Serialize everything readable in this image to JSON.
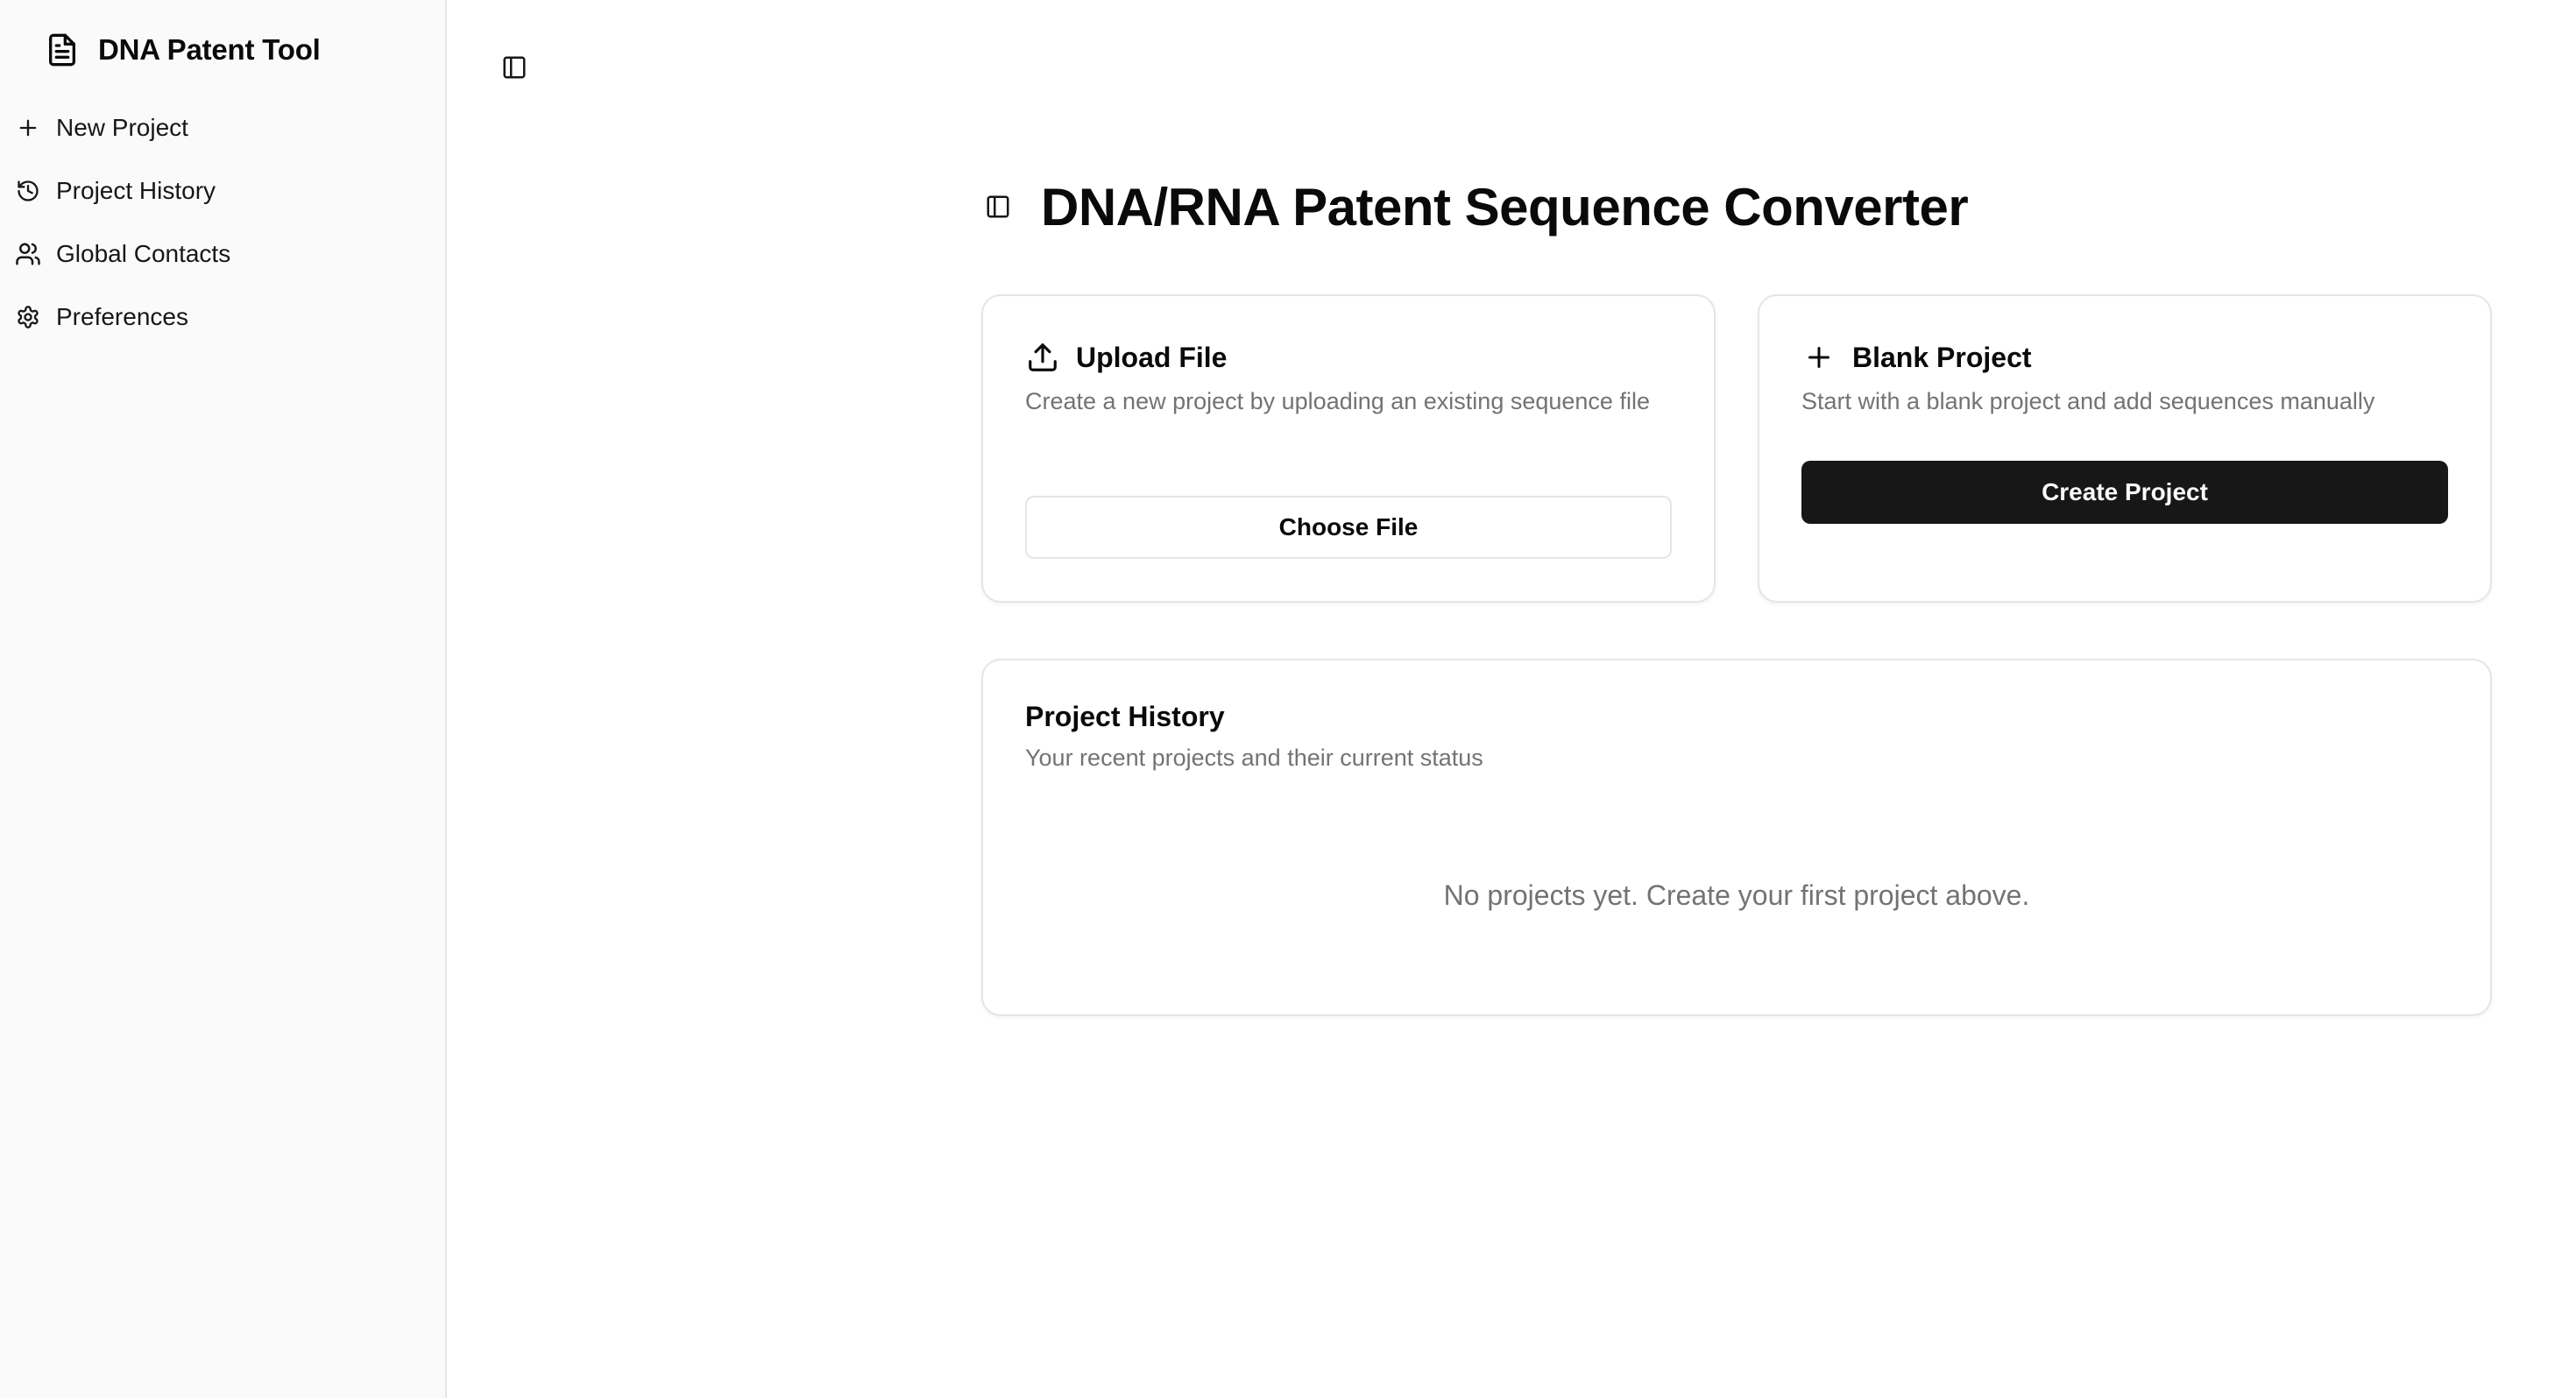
{
  "sidebar": {
    "brand": {
      "title": "DNA Patent Tool",
      "icon": "file-text-icon"
    },
    "items": [
      {
        "label": "New Project",
        "icon": "plus-icon"
      },
      {
        "label": "Project History",
        "icon": "history-icon"
      },
      {
        "label": "Global Contacts",
        "icon": "users-icon"
      },
      {
        "label": "Preferences",
        "icon": "gear-icon"
      }
    ]
  },
  "main": {
    "title": "DNA/RNA Patent Sequence Converter",
    "upload_card": {
      "title": "Upload File",
      "icon": "upload-icon",
      "description": "Create a new project by uploading an existing sequence file",
      "button_label": "Choose File"
    },
    "blank_card": {
      "title": "Blank Project",
      "icon": "plus-icon",
      "description": "Start with a blank project and add sequences manually",
      "button_label": "Create Project"
    },
    "history_card": {
      "title": "Project History",
      "description": "Your recent projects and their current status",
      "empty_message": "No projects yet. Create your first project above."
    }
  },
  "colors": {
    "sidebar_bg": "#fafafa",
    "border": "#e5e5e5",
    "primary_button": "#171717",
    "muted_text": "#737373"
  }
}
